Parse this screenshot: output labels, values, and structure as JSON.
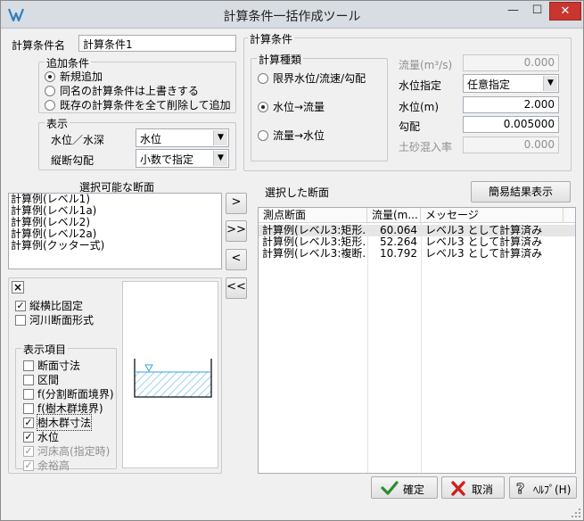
{
  "window": {
    "title": "計算条件一括作成ツール",
    "min_symbol": "—",
    "max_symbol": "☐",
    "close_symbol": "✕"
  },
  "calc_name": {
    "label": "計算条件名",
    "value": "計算条件1"
  },
  "add_conditions": {
    "title": "追加条件",
    "options": [
      {
        "label": "新規追加",
        "selected": true
      },
      {
        "label": "同名の計算条件は上書きする",
        "selected": false
      },
      {
        "label": "既存の計算条件を全て削除して追加",
        "selected": false
      }
    ]
  },
  "display": {
    "title": "表示",
    "water_level_label": "水位／水深",
    "water_level_value": "水位",
    "slope_label": "縦断勾配",
    "slope_value": "小数で指定"
  },
  "calc_conditions": {
    "title": "計算条件",
    "calc_type": {
      "title": "計算種類",
      "options": [
        {
          "label": "限界水位/流速/勾配",
          "selected": false
        },
        {
          "label": "水位→流量",
          "selected": true
        },
        {
          "label": "流量→水位",
          "selected": false
        }
      ]
    },
    "flow_label": "流量(m³/s)",
    "flow_value": "0.000",
    "level_spec_label": "水位指定",
    "level_spec_value": "任意指定",
    "level_label": "水位(m)",
    "level_value": "2.000",
    "gradient_label": "勾配",
    "gradient_value": "0.005000",
    "sediment_label": "土砂混入率",
    "sediment_value": "0.000"
  },
  "available_sections": {
    "title": "選択可能な断面",
    "items": [
      "計算例(レベル1)",
      "計算例(レベル1a)",
      "計算例(レベル2)",
      "計算例(レベル2a)",
      "計算例(クッター式)"
    ]
  },
  "move_buttons": {
    "add_one": ">",
    "add_all": ">>",
    "remove_one": "<",
    "remove_all": "<<"
  },
  "selected_sections": {
    "title": "選択した断面",
    "simple_result_button": "簡易結果表示",
    "columns": [
      "測点断面",
      "流量(m...",
      "メッセージ"
    ],
    "rows": [
      {
        "section": "計算例(レベル3:矩形...",
        "flow": "60.064",
        "message": "レベル3 として計算済み"
      },
      {
        "section": "計算例(レベル3:矩形...",
        "flow": "52.264",
        "message": "レベル3 として計算済み"
      },
      {
        "section": "計算例(レベル3:複断...",
        "flow": "10.792",
        "message": "レベル3 として計算済み"
      }
    ]
  },
  "options_panel": {
    "close_symbol": "×",
    "fixed_ratio": {
      "label": "縦横比固定",
      "checked": true
    },
    "river_section": {
      "label": "河川断面形式",
      "checked": false
    },
    "display_items": {
      "title": "表示項目",
      "items": [
        {
          "label": "断面寸法",
          "checked": false,
          "disabled": false
        },
        {
          "label": "区間",
          "checked": false,
          "disabled": false
        },
        {
          "label": "f(分割断面境界)",
          "checked": false,
          "disabled": false
        },
        {
          "label": "f(樹木群境界)",
          "checked": false,
          "disabled": false
        },
        {
          "label": "樹木群寸法",
          "checked": true,
          "disabled": false
        },
        {
          "label": "水位",
          "checked": true,
          "disabled": false
        },
        {
          "label": "河床高(指定時)",
          "checked": true,
          "disabled": true
        },
        {
          "label": "余裕高",
          "checked": true,
          "disabled": true
        }
      ]
    }
  },
  "footer": {
    "confirm_label": "確定",
    "cancel_label": "取消",
    "help_label": "ﾍﾙﾌﾟ(H)"
  },
  "colors": {
    "confirm_check": "#2e8b2e",
    "cancel_x": "#cc2020",
    "water_hatch": "#7fc4e8",
    "close_button": "#c7372f"
  }
}
